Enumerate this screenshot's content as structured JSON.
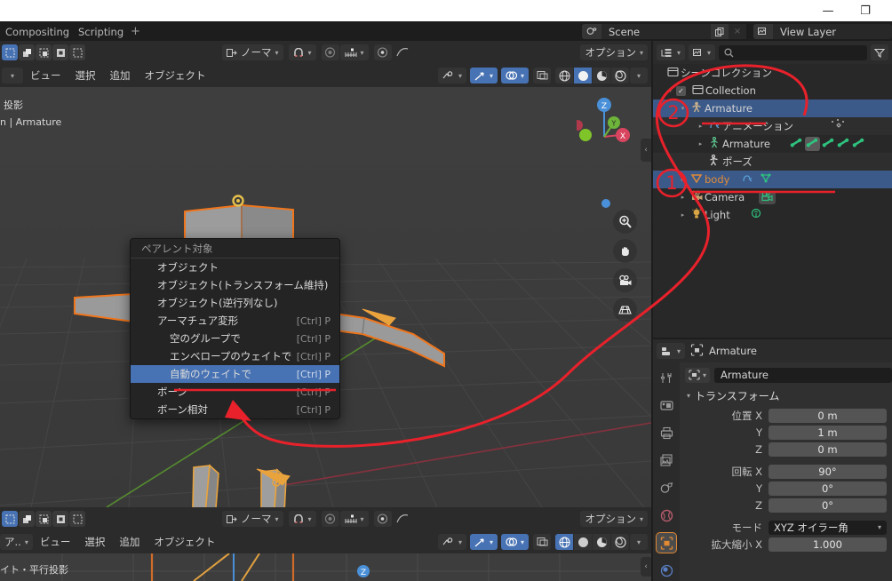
{
  "os": {
    "minimize": "—",
    "maximize": "❐"
  },
  "topbar": {
    "workspaces": [
      "Compositing",
      "Scripting"
    ],
    "add_workspace": "+",
    "scene": {
      "icon": "scene-icon",
      "name": "Scene",
      "copy": "copy-icon",
      "delete": "×"
    },
    "view_layer": {
      "icon": "viewlayer-icon",
      "name": "View Layer"
    }
  },
  "viewport": {
    "mode_buttons": [
      "object-mode-icon",
      "vertex-select-icon",
      "edge-select-icon",
      "face-select-icon",
      "box-select-icon"
    ],
    "transform_orientation": "ノーマ",
    "snap_icon": "magnet-icon",
    "proportional_icon": "proportional-icon",
    "proportional_falloff_icon": "falloff-icon",
    "pivot_icon": "pivot-icon",
    "menus": [
      "ビュー",
      "選択",
      "追加",
      "オブジェクト"
    ],
    "options_label": "オプション",
    "visibility_icon": "eye-icon",
    "gizmo_icon": "gizmo-icon",
    "overlays_icon": "overlays-icon",
    "xray_icon": "xray-icon",
    "shading": [
      "wireframe-icon",
      "solid-icon",
      "material-icon",
      "rendered-icon"
    ],
    "overlay_text_line1": "投影",
    "overlay_text_line2": "n | Armature",
    "gizmo_axes": [
      "Z",
      "Y",
      "X"
    ],
    "nav_buttons": [
      "zoom-icon",
      "hand-icon",
      "camera-icon",
      "grid-icon"
    ],
    "sidebar_arrow": "‹"
  },
  "viewport_bottom": {
    "mode_buttons": [
      "object-mode-icon",
      "vertex-select-icon",
      "edge-select-icon",
      "face-select-icon",
      "box-select-icon"
    ],
    "transform_orientation": "ノーマ",
    "menus": [
      "ビュー",
      "選択",
      "追加",
      "オブジェクト"
    ],
    "options_label": "オプション",
    "left_dd": "ア..",
    "overlay_text": "イト・平行投影",
    "gizmo_axis": "Z",
    "sidebar_arrow": "‹"
  },
  "context_menu": {
    "title": "ペアレント対象",
    "items": [
      {
        "label": "オブジェクト",
        "key": "",
        "indent": false,
        "highlight": false
      },
      {
        "label": "オブジェクト(トランスフォーム維持)",
        "key": "",
        "indent": false,
        "highlight": false
      },
      {
        "label": "オブジェクト(逆行列なし)",
        "key": "",
        "indent": false,
        "highlight": false
      },
      {
        "label": "アーマチュア変形",
        "key": "[Ctrl] P",
        "indent": false,
        "highlight": false
      },
      {
        "label": "空のグループで",
        "key": "[Ctrl] P",
        "indent": true,
        "highlight": false
      },
      {
        "label": "エンベロープのウェイトで",
        "key": "[Ctrl] P",
        "indent": true,
        "highlight": false
      },
      {
        "label": "自動のウェイトで",
        "key": "[Ctrl] P",
        "indent": true,
        "highlight": true
      },
      {
        "label": "ボーン",
        "key": "[Ctrl] P",
        "indent": false,
        "highlight": false
      },
      {
        "label": "ボーン相対",
        "key": "[Ctrl] P",
        "indent": false,
        "highlight": false
      }
    ]
  },
  "outliner": {
    "display_mode_icon": "outliner-display-icon",
    "filter_id_icon": "viewlayer-icon",
    "search_placeholder": "",
    "filter_icon": "filter-icon",
    "rows": [
      {
        "label": "シーンコレクション",
        "icon": "collection-icon",
        "indent": 0,
        "disclosure": "",
        "checkbox": false,
        "selected": false,
        "shade": false,
        "color": "#d2d2d2"
      },
      {
        "label": "Collection",
        "icon": "collection-icon",
        "indent": 1,
        "disclosure": "▾",
        "checkbox": true,
        "selected": false,
        "shade": false,
        "color": "#d2d2d2"
      },
      {
        "label": "Armature",
        "icon": "armature-object-icon",
        "indent": 2,
        "disclosure": "▾",
        "checkbox": false,
        "selected": true,
        "shade": false,
        "color": "#e8e8e8"
      },
      {
        "label": "アニメーション",
        "icon": "animation-icon",
        "indent": 3,
        "disclosure": "▸",
        "checkbox": false,
        "selected": false,
        "shade": true,
        "color": "#d2d2d2"
      },
      {
        "label": "Armature",
        "icon": "armature-data-icon",
        "indent": 3,
        "disclosure": "▸",
        "checkbox": false,
        "selected": false,
        "shade": false,
        "color": "#d2d2d2"
      },
      {
        "label": "ポーズ",
        "icon": "pose-icon",
        "indent": 3,
        "disclosure": "",
        "checkbox": false,
        "selected": false,
        "shade": true,
        "color": "#d2d2d2"
      },
      {
        "label": "body",
        "icon": "mesh-object-icon",
        "indent": 2,
        "disclosure": "▸",
        "checkbox": false,
        "selected": true,
        "shade": false,
        "color": "#e08a36"
      },
      {
        "label": "Camera",
        "icon": "camera-object-icon",
        "indent": 2,
        "disclosure": "▸",
        "checkbox": false,
        "selected": false,
        "shade": false,
        "color": "#d2d2d2"
      },
      {
        "label": "Light",
        "icon": "light-object-icon",
        "indent": 2,
        "disclosure": "▸",
        "checkbox": false,
        "selected": false,
        "shade": false,
        "color": "#d2d2d2"
      }
    ],
    "bone_count": 5,
    "selected_bone_index": 1
  },
  "properties": {
    "editor_icon": "properties-editor-icon",
    "header_name": "Armature",
    "tabs": [
      "tool-icon",
      "render-icon",
      "output-icon",
      "viewlayer-props-icon",
      "scene-props-icon",
      "world-icon",
      "object-icon",
      "physics-icon"
    ],
    "active_tab_index": 6,
    "breadcrumb_icon": "object-icon",
    "datablock_name": "Armature",
    "panel_title": "トランスフォーム",
    "fields": [
      {
        "label": "位置 X",
        "value": "0 m",
        "type": "value"
      },
      {
        "label": "Y",
        "value": "1 m",
        "type": "value"
      },
      {
        "label": "Z",
        "value": "0 m",
        "type": "value"
      },
      {
        "label": "",
        "value": "",
        "type": "gap"
      },
      {
        "label": "回転 X",
        "value": "90°",
        "type": "value"
      },
      {
        "label": "Y",
        "value": "0°",
        "type": "value"
      },
      {
        "label": "Z",
        "value": "0°",
        "type": "value"
      },
      {
        "label": "",
        "value": "",
        "type": "gap"
      },
      {
        "label": "モード",
        "value": "XYZ オイラー角",
        "type": "select"
      },
      {
        "label": "拡大縮小 X",
        "value": "1.000",
        "type": "value"
      }
    ]
  },
  "annotations": {
    "marker_1": "1",
    "marker_2": "2",
    "accent_red": "#e8212b",
    "accent_blue": "#4772b3",
    "accent_orange": "#e08a36"
  }
}
